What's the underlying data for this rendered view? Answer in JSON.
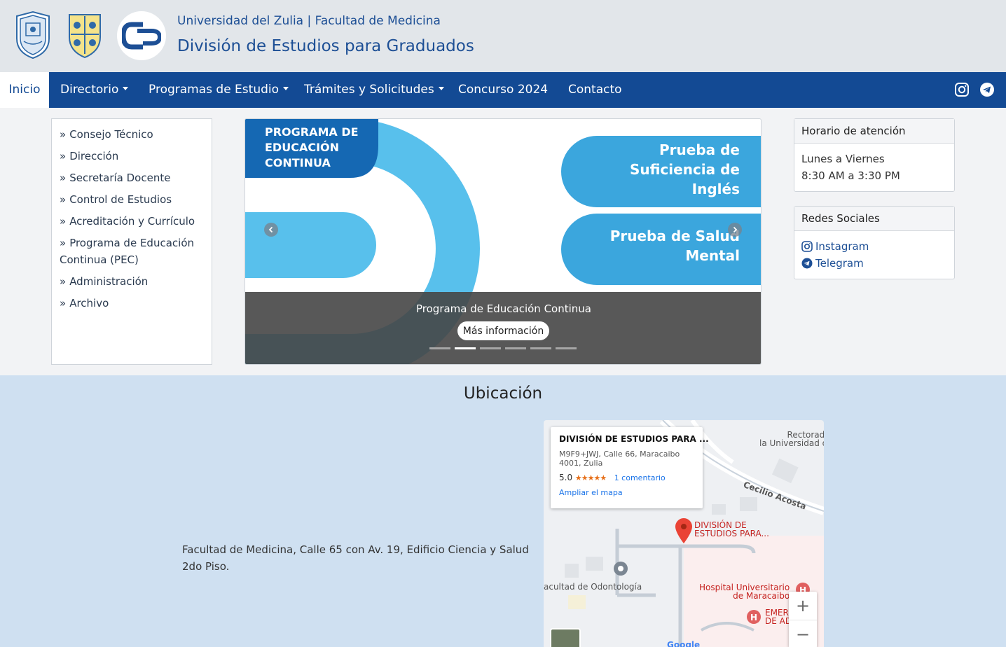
{
  "header": {
    "subtitle": "Universidad del Zulia | Facultad de Medicina",
    "title": "División de Estudios para Graduados"
  },
  "nav": {
    "items": [
      "Inicio",
      "Directorio",
      "Programas de Estudio",
      "Trámites y Solicitudes",
      "Concurso 2024",
      "Contacto"
    ],
    "active": "Inicio"
  },
  "sidebar": {
    "items": [
      "Consejo Técnico",
      "Dirección",
      "Secretaría Docente",
      "Control de Estudios",
      "Acreditación y Currículo",
      "Programa de Educación",
      "Continua (PEC)",
      "Administración",
      "Archivo"
    ]
  },
  "carousel": {
    "banner_label_lines": [
      "PROGRAMA DE",
      "EDUCACIÓN",
      "CONTINUA"
    ],
    "pill1_lines": [
      "Prueba de",
      "Suficiencia de",
      "Inglés"
    ],
    "pill2_lines": [
      "Prueba de Salud",
      "Mental"
    ],
    "caption": "Programa de Educación Continua",
    "button": "Más información",
    "slide_count": 6,
    "active_slide": 2,
    "colors": {
      "light_blue": "#58c0ec",
      "mid_blue": "#3ba6dd",
      "dark_blue": "#1568b3"
    }
  },
  "hours": {
    "title": "Horario de atención",
    "days": "Lunes a Viernes",
    "time": "8:30 AM a 3:30 PM"
  },
  "social": {
    "title": "Redes Sociales",
    "instagram": "Instagram",
    "telegram": "Telegram"
  },
  "location": {
    "title": "Ubicación",
    "address": "Facultad de Medicina, Calle 65 con Av. 19, Edificio Ciencia y Salud 2do Piso."
  },
  "map": {
    "place_name": "DIVISIÓN DE ESTUDIOS PARA ...",
    "address": "M9F9+JWJ, Calle 66, Maracaibo 4001, Zulia",
    "rating": "5.0",
    "stars": "★★★★★",
    "reviews": "1 comentario",
    "enlarge": "Ampliar el mapa",
    "pin_label": [
      "DIVISIÓN DE",
      "ESTUDIOS PARA..."
    ],
    "rectorado": [
      "Rectorado de",
      "la Universidad del..."
    ],
    "street": "Cecilio Acosta",
    "odonto": "acultad de Odontología",
    "hospital": [
      "Hospital Universitario",
      "de Maracaibo"
    ],
    "emergency": [
      "EMER",
      "DE AD"
    ],
    "zoom_in": "+",
    "zoom_out": "−",
    "google": "Google"
  }
}
